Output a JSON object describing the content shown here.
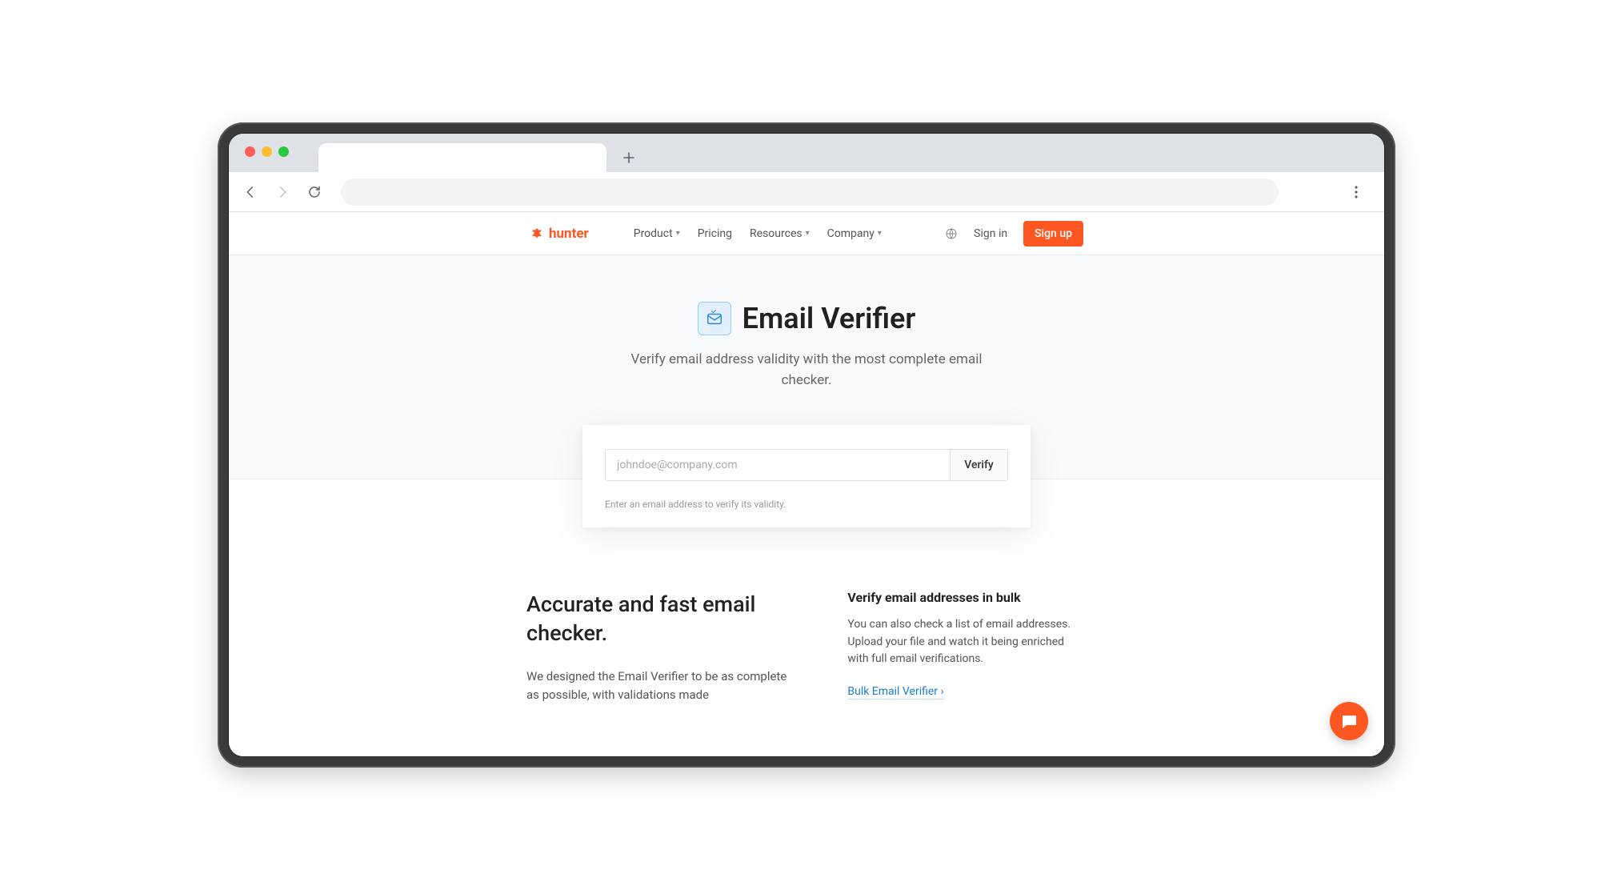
{
  "browser": {
    "new_tab_tooltip": "New tab"
  },
  "site": {
    "logo_text": "hunter",
    "nav": {
      "product": "Product",
      "pricing": "Pricing",
      "resources": "Resources",
      "company": "Company"
    },
    "signin": "Sign in",
    "signup": "Sign up"
  },
  "hero": {
    "title": "Email Verifier",
    "subtitle": "Verify email address validity with the most complete email checker."
  },
  "verifier": {
    "placeholder": "johndoe@company.com",
    "button": "Verify",
    "hint": "Enter an email address to verify its validity."
  },
  "section_left": {
    "heading": "Accurate and fast email checker.",
    "body": "We designed the Email Verifier to be as complete as possible, with validations made"
  },
  "section_right": {
    "heading": "Verify email addresses in bulk",
    "body": "You can also check a list of email addresses. Upload your file and watch it being enriched with full email verifications.",
    "link": "Bulk Email Verifier ›"
  }
}
